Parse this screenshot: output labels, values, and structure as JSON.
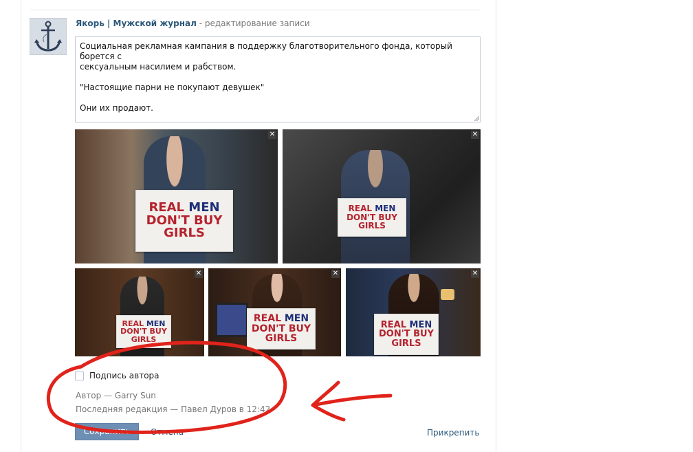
{
  "post": {
    "author_name": "Якорь | Мужской журнал",
    "action_text": " - редактирование записи",
    "avatar_icon": "anchor-icon",
    "text_lines": [
      "Социальная рекламная кампания в поддержку благотворительного фонда, который борется с",
      "сексуальным насилием и рабством.",
      "",
      "\"Настоящие парни не покупают девушек\"",
      "",
      "Они их продают."
    ]
  },
  "photos": [
    {
      "sign_l1a": "REAL",
      "sign_l1b": "MEN",
      "sign_l2": "DON'T BUY",
      "sign_l3": "GIRLS",
      "close": "✕"
    },
    {
      "sign_l1a": "REAL",
      "sign_l1b": "MEN",
      "sign_l2": "DON'T BUY",
      "sign_l3": "GIRLS",
      "close": "✕"
    },
    {
      "sign_l1a": "REAL",
      "sign_l1b": "MEN",
      "sign_l2": "DON'T BUY",
      "sign_l3": "GIRLS",
      "close": "✕"
    },
    {
      "sign_l1a": "REAL",
      "sign_l1b": "MEN",
      "sign_l2": "DON'T BUY",
      "sign_l3": "GIRLS",
      "close": "✕"
    },
    {
      "sign_l1a": "REAL",
      "sign_l1b": "MEN",
      "sign_l2": "DON'T BUY",
      "sign_l3": "GIRLS",
      "close": "✕"
    }
  ],
  "signature_label": "Подпись автора",
  "meta": {
    "author_line": "Автор — Garry Sun",
    "last_edit_line": "Последняя редакция — Павел Дуров в 12:42"
  },
  "actions": {
    "save_label": "Сохранить",
    "cancel_label": "Отмена",
    "attach_label": "Прикрепить"
  },
  "colors": {
    "link": "#2b587a",
    "button": "#6d8fb3",
    "annotation": "#e0231b",
    "sign_red": "#b5232e",
    "sign_blue": "#1e2f78"
  }
}
